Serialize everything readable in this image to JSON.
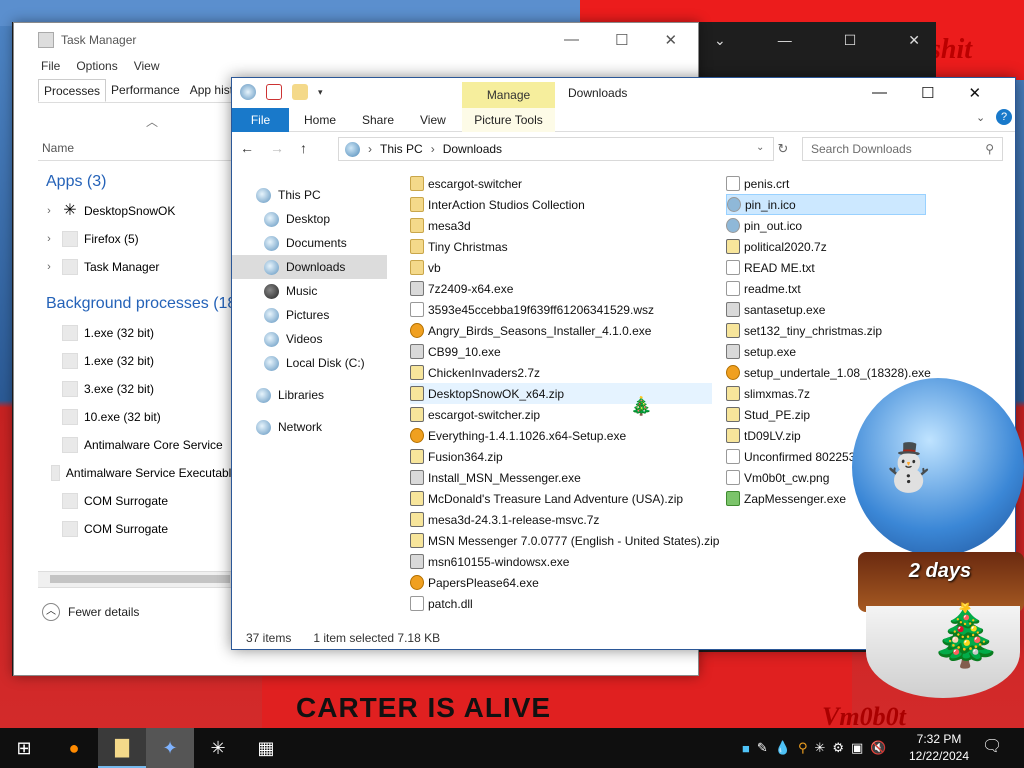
{
  "wallpaper": {
    "caption": "CARTER IS ALIVE",
    "corner_text": "shit",
    "signature": "Vm0b0t"
  },
  "task_manager": {
    "title": "Task Manager",
    "menu": [
      "File",
      "Options",
      "View"
    ],
    "tabs": [
      "Processes",
      "Performance",
      "App history"
    ],
    "column": "Name",
    "apps_header": "Apps (3)",
    "apps": [
      "DesktopSnowOK",
      "Firefox (5)",
      "Task Manager"
    ],
    "bg_header": "Background processes (18)",
    "background": [
      "1.exe (32 bit)",
      "1.exe (32 bit)",
      "3.exe (32 bit)",
      "10.exe (32 bit)",
      "Antimalware Core Service",
      "Antimalware Service Executable",
      "COM Surrogate",
      "COM Surrogate"
    ],
    "fewer_details": "Fewer details"
  },
  "explorer": {
    "title": "Downloads",
    "manage": "Manage",
    "ribbon": {
      "file": "File",
      "home": "Home",
      "share": "Share",
      "view": "View",
      "picture_tools": "Picture Tools"
    },
    "address": {
      "root": "This PC",
      "current": "Downloads"
    },
    "search_placeholder": "Search Downloads",
    "nav": [
      "This PC",
      "Desktop",
      "Documents",
      "Downloads",
      "Music",
      "Pictures",
      "Videos",
      "Local Disk (C:)",
      "Libraries",
      "Network"
    ],
    "files_col1": [
      {
        "name": "escargot-switcher",
        "kind": "folder"
      },
      {
        "name": "InterAction Studios Collection",
        "kind": "folder"
      },
      {
        "name": "mesa3d",
        "kind": "folder"
      },
      {
        "name": "Tiny Christmas",
        "kind": "folder"
      },
      {
        "name": "vb",
        "kind": "folder"
      },
      {
        "name": "7z2409-x64.exe",
        "kind": "exe"
      },
      {
        "name": "3593e45ccebba19f639ff61206341529.wsz",
        "kind": "txt"
      },
      {
        "name": "Angry_Birds_Seasons_Installer_4.1.0.exe",
        "kind": "orange"
      },
      {
        "name": "CB99_10.exe",
        "kind": "exe"
      },
      {
        "name": "ChickenInvaders2.7z",
        "kind": "zip"
      },
      {
        "name": "DesktopSnowOK_x64.zip",
        "kind": "zip"
      },
      {
        "name": "escargot-switcher.zip",
        "kind": "zip"
      },
      {
        "name": "Everything-1.4.1.1026.x64-Setup.exe",
        "kind": "orange"
      },
      {
        "name": "Fusion364.zip",
        "kind": "zip"
      },
      {
        "name": "Install_MSN_Messenger.exe",
        "kind": "exe"
      },
      {
        "name": "McDonald's Treasure Land Adventure (USA).zip",
        "kind": "zip"
      },
      {
        "name": "mesa3d-24.3.1-release-msvc.7z",
        "kind": "zip"
      },
      {
        "name": "MSN Messenger 7.0.0777 (English - United States).zip",
        "kind": "zip"
      },
      {
        "name": "msn610155-windowsx.exe",
        "kind": "exe"
      },
      {
        "name": "PapersPlease64.exe",
        "kind": "orange"
      },
      {
        "name": "patch.dll",
        "kind": "txt"
      }
    ],
    "files_col2": [
      {
        "name": "penis.crt",
        "kind": "txt"
      },
      {
        "name": "pin_in.ico",
        "kind": "gear"
      },
      {
        "name": "pin_out.ico",
        "kind": "gear"
      },
      {
        "name": "political2020.7z",
        "kind": "zip"
      },
      {
        "name": "READ ME.txt",
        "kind": "txt"
      },
      {
        "name": "readme.txt",
        "kind": "txt"
      },
      {
        "name": "santasetup.exe",
        "kind": "exe"
      },
      {
        "name": "set132_tiny_christmas.zip",
        "kind": "zip"
      },
      {
        "name": "setup.exe",
        "kind": "exe"
      },
      {
        "name": "setup_undertale_1.08_(18328).exe",
        "kind": "orange"
      },
      {
        "name": "slimxmas.7z",
        "kind": "zip"
      },
      {
        "name": "Stud_PE.zip",
        "kind": "zip"
      },
      {
        "name": "tD09LV.zip",
        "kind": "zip"
      },
      {
        "name": "Unconfirmed 802253.c",
        "kind": "txt"
      },
      {
        "name": "Vm0b0t_cw.png",
        "kind": "txt"
      },
      {
        "name": "ZapMessenger.exe",
        "kind": "green"
      }
    ],
    "status": {
      "count": "37 items",
      "selected": "1 item selected  7.18 KB"
    }
  },
  "widget": {
    "days": "2 days"
  },
  "taskbar": {
    "time": "7:32 PM",
    "date": "12/22/2024"
  }
}
